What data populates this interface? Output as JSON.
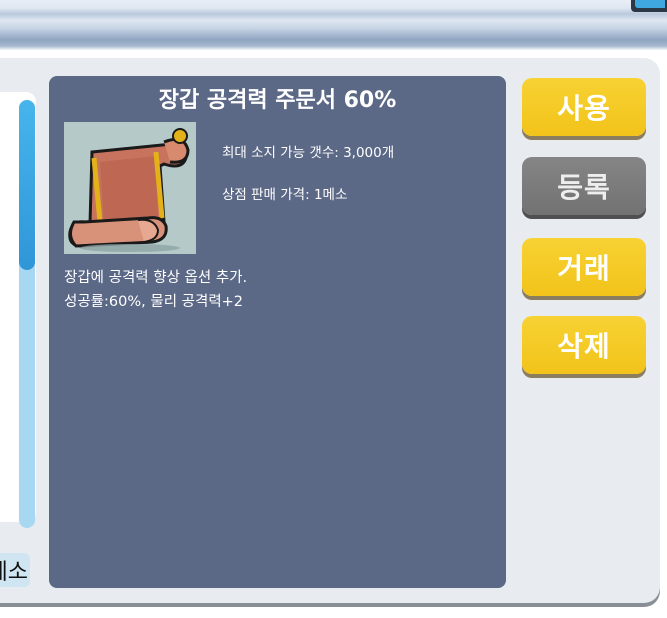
{
  "item": {
    "title": "장갑 공격력 주문서 60%",
    "max_stack": "최대 소지 가능 갯수: 3,000개",
    "shop_price": "상점 판매 가격: 1메소",
    "description_line1": "장갑에 공격력 향상 옵션 추가.",
    "description_line2": "성공률:60%, 물리 공격력+2",
    "icon": "scroll-icon"
  },
  "buttons": {
    "use": "사용",
    "register": "등록",
    "trade": "거래",
    "delete": "삭제"
  },
  "sidebar": {
    "meso_label": "메소"
  },
  "colors": {
    "panel_bg": "#5b6886",
    "button_yellow": "#f2c31a",
    "button_gray": "#7a7a7a",
    "scrollbar": "#3aa6e4"
  }
}
